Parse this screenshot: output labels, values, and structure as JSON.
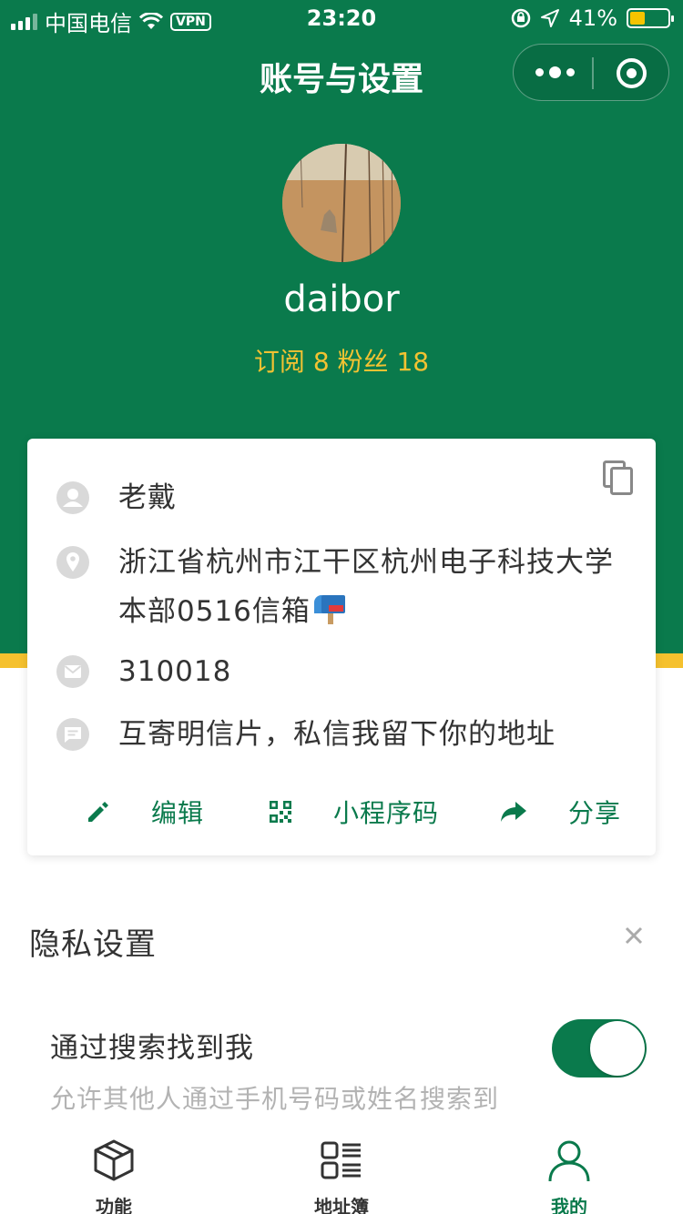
{
  "status_bar": {
    "carrier": "中国电信",
    "vpn": "VPN",
    "time": "23:20",
    "battery": "41%",
    "battery_level": 0.41
  },
  "nav": {
    "title": "账号与设置"
  },
  "profile": {
    "username": "daibor",
    "stats": "订阅 8 粉丝 18"
  },
  "card": {
    "name": "老戴",
    "address": "浙江省杭州市江干区杭州电子科技大学本部0516信箱",
    "postcode": "310018",
    "message": "互寄明信片，私信我留下你的地址",
    "actions": {
      "edit": "编辑",
      "qrcode": "小程序码",
      "share": "分享"
    }
  },
  "privacy": {
    "title": "隐私设置",
    "search_setting": {
      "title": "通过搜索找到我",
      "description": "允许其他人通过手机号码或姓名搜索到我",
      "enabled": true
    }
  },
  "tabbar": {
    "tabs": [
      {
        "label": "功能",
        "icon": "cube-icon"
      },
      {
        "label": "地址簿",
        "icon": "list-icon"
      },
      {
        "label": "我的",
        "icon": "person-icon",
        "active": true
      }
    ]
  },
  "colors": {
    "primary": "#0a7a4c",
    "accent": "#f5c12e",
    "stats_text": "#f2c232"
  }
}
